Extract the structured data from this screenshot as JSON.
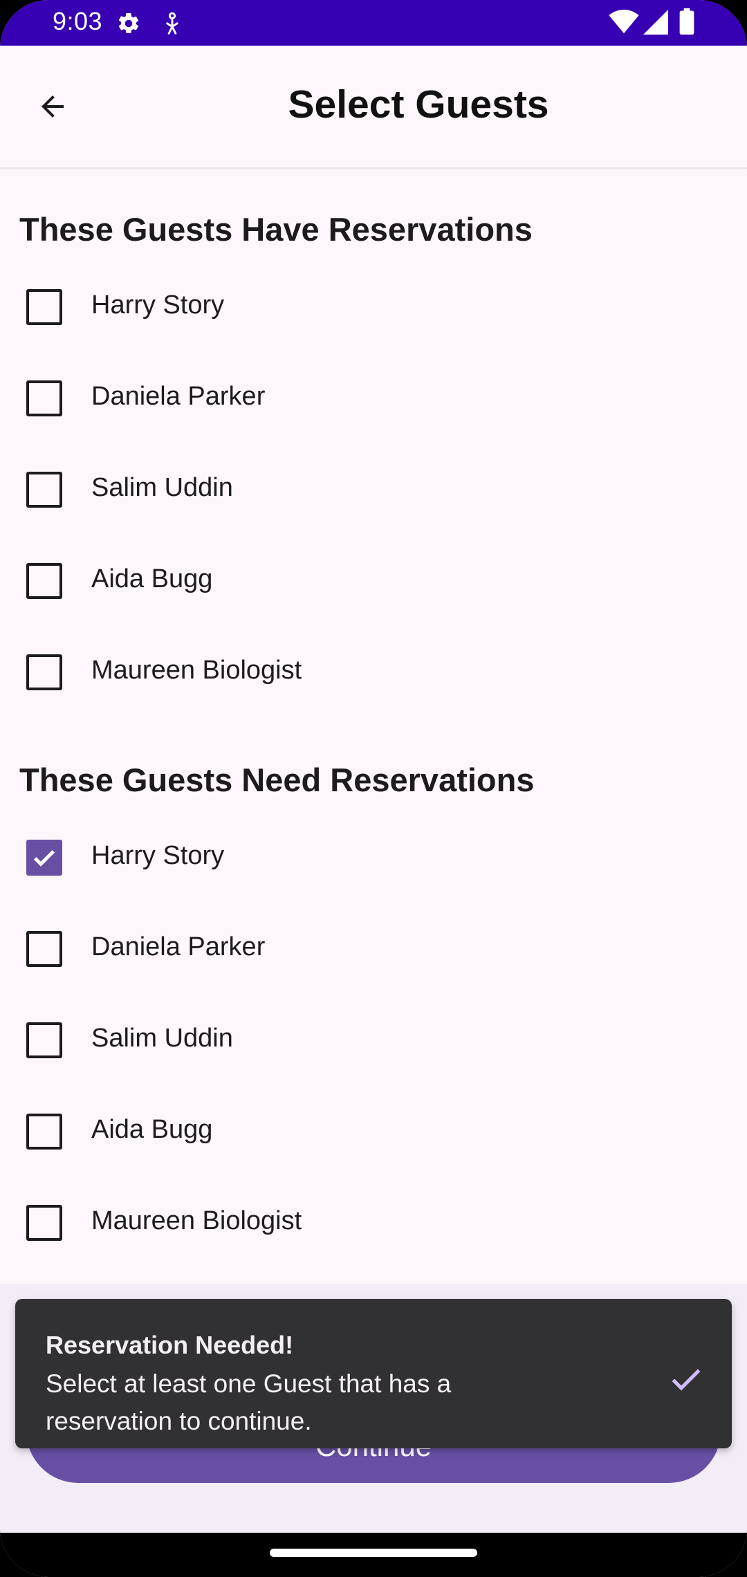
{
  "status_bar": {
    "time": "9:03",
    "icons_left": [
      "settings-icon",
      "accessibility-icon"
    ],
    "icons_right": [
      "wifi-icon",
      "signal-icon",
      "battery-icon"
    ]
  },
  "app_bar": {
    "title": "Select Guests",
    "back_icon": "arrow-back-icon"
  },
  "sections": [
    {
      "title": "These Guests Have Reservations",
      "guests": [
        {
          "name": "Harry Story",
          "checked": false
        },
        {
          "name": "Daniela Parker",
          "checked": false
        },
        {
          "name": "Salim Uddin",
          "checked": false
        },
        {
          "name": "Aida Bugg",
          "checked": false
        },
        {
          "name": "Maureen Biologist",
          "checked": false
        }
      ]
    },
    {
      "title": "These Guests Need Reservations",
      "guests": [
        {
          "name": "Harry Story",
          "checked": true
        },
        {
          "name": "Daniela Parker",
          "checked": false
        },
        {
          "name": "Salim Uddin",
          "checked": false
        },
        {
          "name": "Aida Bugg",
          "checked": false
        },
        {
          "name": "Maureen Biologist",
          "checked": false
        }
      ]
    }
  ],
  "continue_button": {
    "label": "Continue"
  },
  "snackbar": {
    "title": "Reservation Needed!",
    "message": "Select at least one Guest that has a reservation to continue.",
    "action_icon": "check-icon"
  },
  "colors": {
    "status_bar": "#3700b3",
    "accent": "#6750a4",
    "snackbar_bg": "#313033",
    "snackbar_action": "#d0bcff",
    "background": "#fdf7fc"
  }
}
